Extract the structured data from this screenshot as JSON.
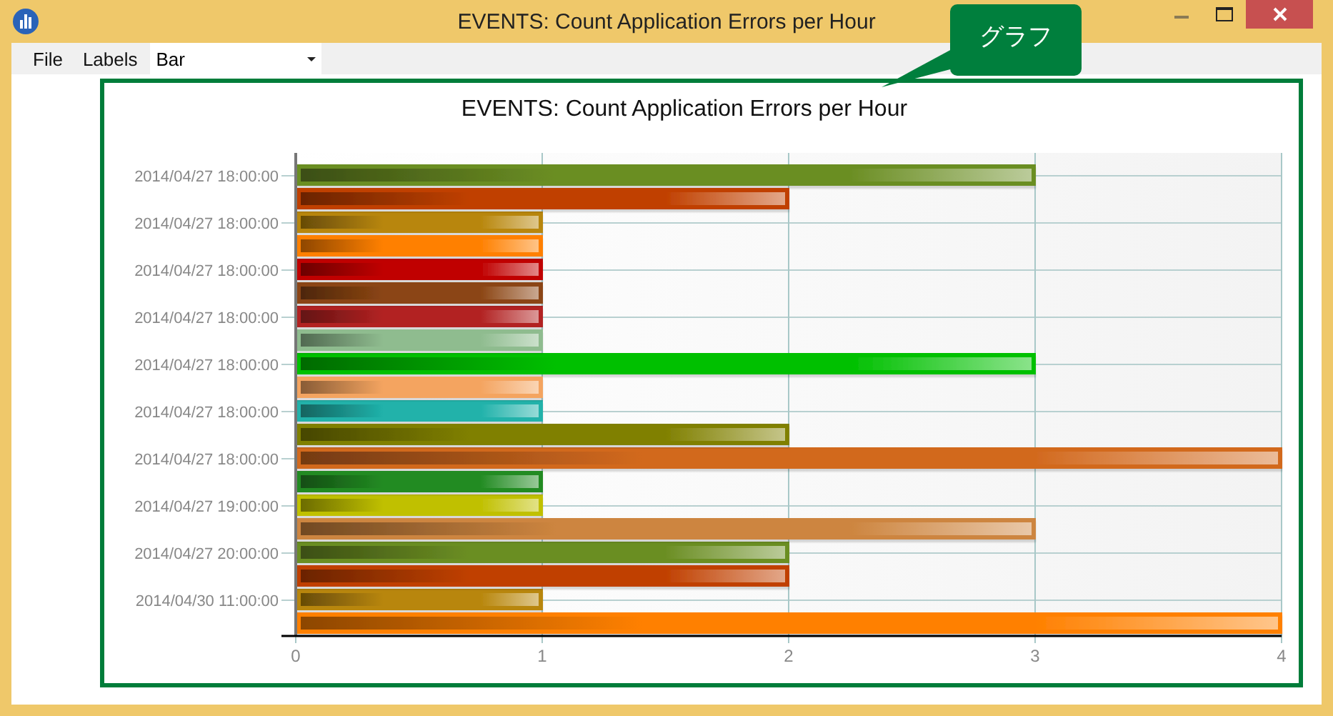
{
  "window": {
    "title": "EVENTS: Count Application Errors per Hour"
  },
  "menu": [
    {
      "label": "File"
    },
    {
      "label": "Labels"
    }
  ],
  "chart_type_select": {
    "value": "Bar"
  },
  "callout": {
    "text": "グラフ"
  },
  "chart": {
    "chart_data": {
      "type": "bar",
      "orientation": "horizontal",
      "title": "EVENTS: Count Application Errors per Hour",
      "grid": true,
      "categories": [
        "2014/04/27 18:00:00",
        "2014/04/27 18:00:00",
        "2014/04/27 18:00:00",
        "2014/04/27 18:00:00",
        "2014/04/27 18:00:00",
        "2014/04/27 18:00:00",
        "2014/04/27 18:00:00",
        "2014/04/27 19:00:00",
        "2014/04/27 20:00:00",
        "2014/04/30 11:00:00"
      ],
      "series": [
        {
          "values": [
            3,
            1,
            1,
            1,
            3,
            1,
            4,
            1,
            2,
            1
          ],
          "colors": [
            "#6b8e23",
            "#b8860b",
            "#c00000",
            "#b22222",
            "#00c000",
            "#20b2aa",
            "#d2691e",
            "#c0c000",
            "#6b8e23",
            "#b8860b"
          ]
        },
        {
          "values": [
            2,
            1,
            1,
            1,
            1,
            2,
            1,
            3,
            2,
            4
          ],
          "colors": [
            "#c04000",
            "#ff8000",
            "#8b4513",
            "#8fbc8f",
            "#f4a460",
            "#808000",
            "#228b22",
            "#cd853f",
            "#c04000",
            "#ff8000"
          ]
        }
      ],
      "xlim": [
        0,
        4
      ],
      "xticks": [
        0,
        1,
        2,
        3,
        4
      ]
    }
  }
}
